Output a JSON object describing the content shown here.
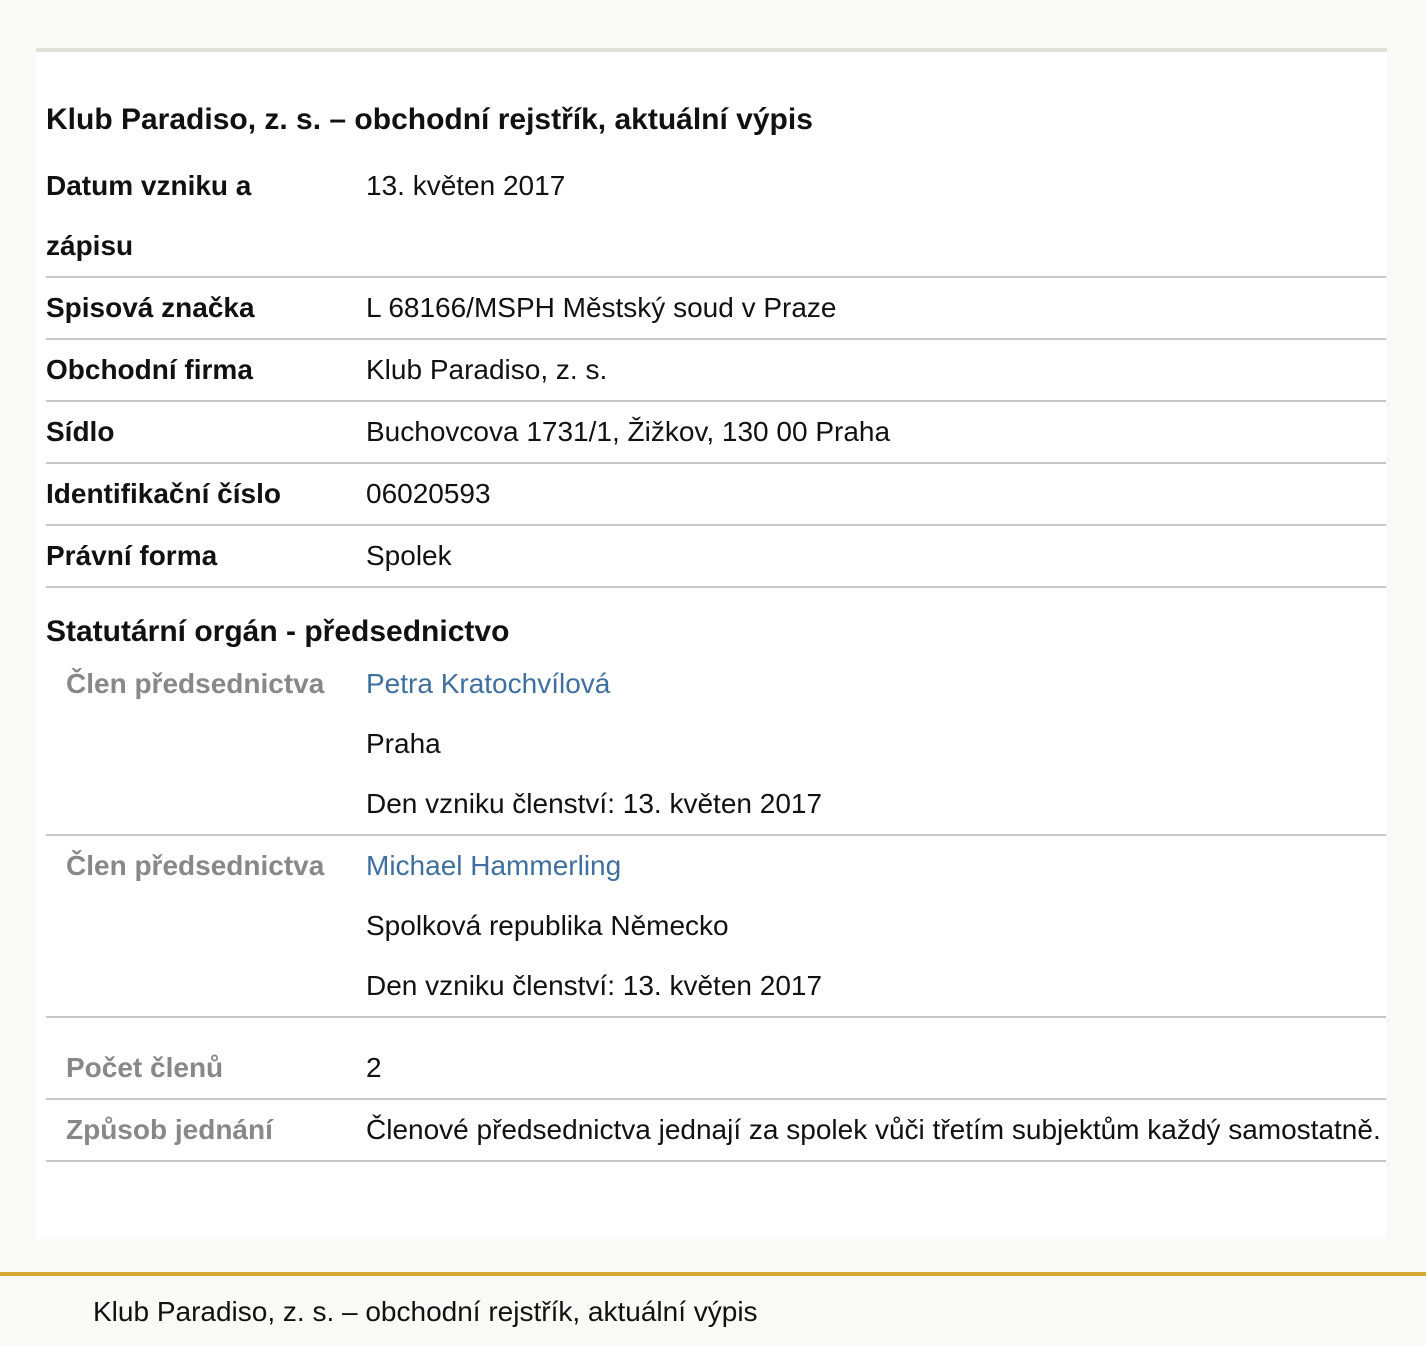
{
  "header": {
    "title": "Klub Paradiso, z. s. – obchodní rejstřík, aktuální výpis"
  },
  "fields": [
    {
      "label": "Datum vzniku a zápisu",
      "value": "13. květen 2017"
    },
    {
      "label": "Spisová značka",
      "value": "L 68166/MSPH Městský soud v Praze"
    },
    {
      "label": "Obchodní firma",
      "value": "Klub Paradiso, z. s."
    },
    {
      "label": "Sídlo",
      "value": "Buchovcova 1731/1, Žižkov, 130 00 Praha"
    },
    {
      "label": "Identifikační číslo",
      "value": "06020593"
    },
    {
      "label": "Právní forma",
      "value": "Spolek"
    }
  ],
  "statutory": {
    "heading": "Statutární orgán - předsednictvo",
    "members": [
      {
        "role": "Člen předsednictva",
        "name": "Petra Kratochvílová",
        "location": "Praha",
        "membership": "Den vzniku členství: 13. květen 2017"
      },
      {
        "role": "Člen předsednictva",
        "name": "Michael Hammerling",
        "location": "Spolková republika Německo",
        "membership": "Den vzniku členství: 13. květen 2017"
      }
    ],
    "member_count": {
      "label": "Počet členů",
      "value": "2"
    },
    "acting": {
      "label": "Způsob jednání",
      "value": "Členové předsednictva jednají za spolek vůči třetím subjektům každý samostatně."
    }
  },
  "footer": {
    "text": "Klub Paradiso, z. s. – obchodní rejstřík, aktuální výpis"
  },
  "colors": {
    "link": "#3f6f9f",
    "footer_accent": "#d4aa35",
    "sub_label": "#888888"
  }
}
